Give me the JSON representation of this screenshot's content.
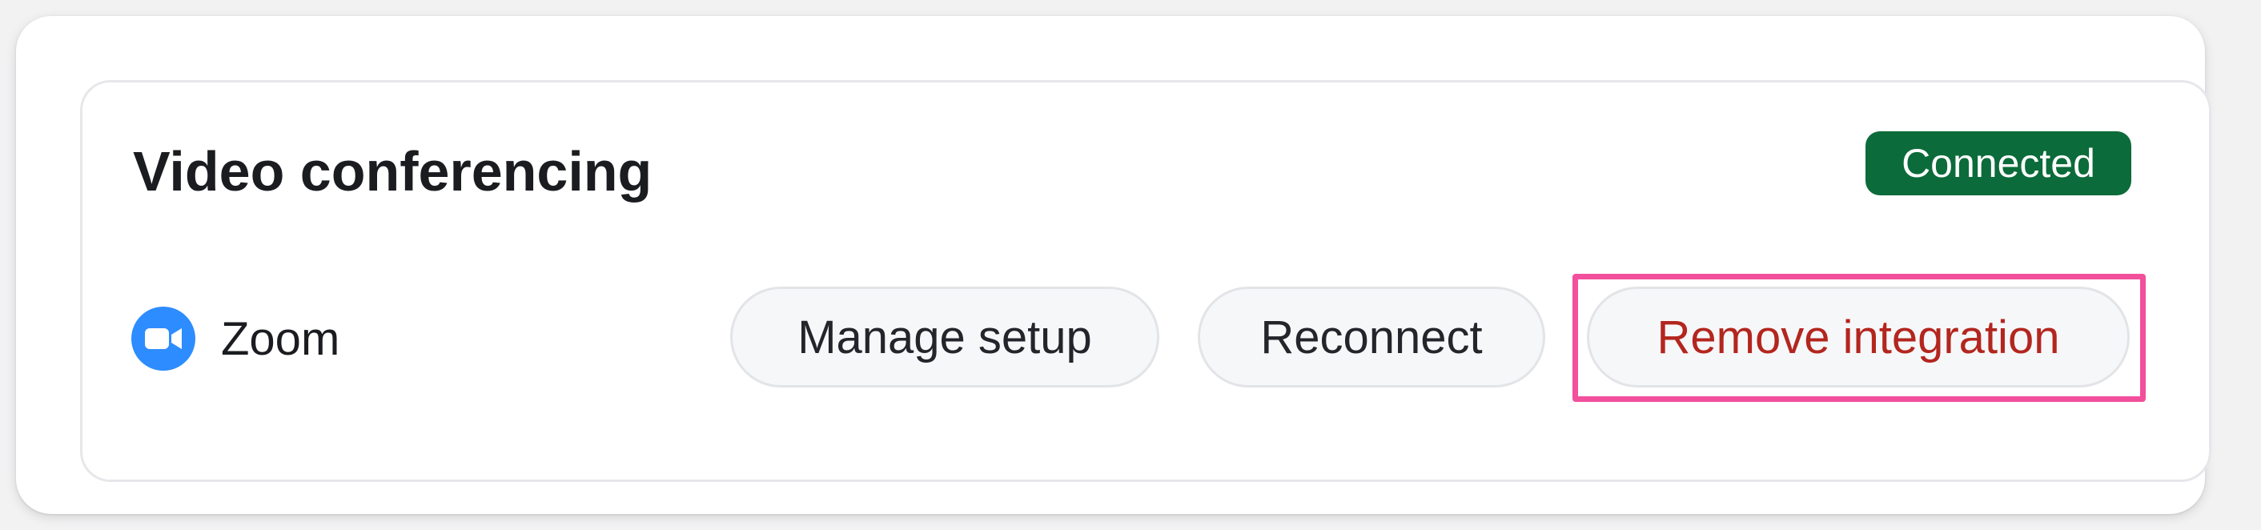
{
  "section": {
    "title": "Video conferencing",
    "status_badge": "Connected"
  },
  "provider": {
    "name": "Zoom",
    "icon": "zoom-video-icon"
  },
  "actions": {
    "manage_label": "Manage setup",
    "reconnect_label": "Reconnect",
    "remove_label": "Remove integration"
  },
  "colors": {
    "status_green": "#0c6b3a",
    "zoom_blue": "#2d8cff",
    "danger_red": "#b3261e",
    "highlight_pink": "#f24f9c"
  }
}
